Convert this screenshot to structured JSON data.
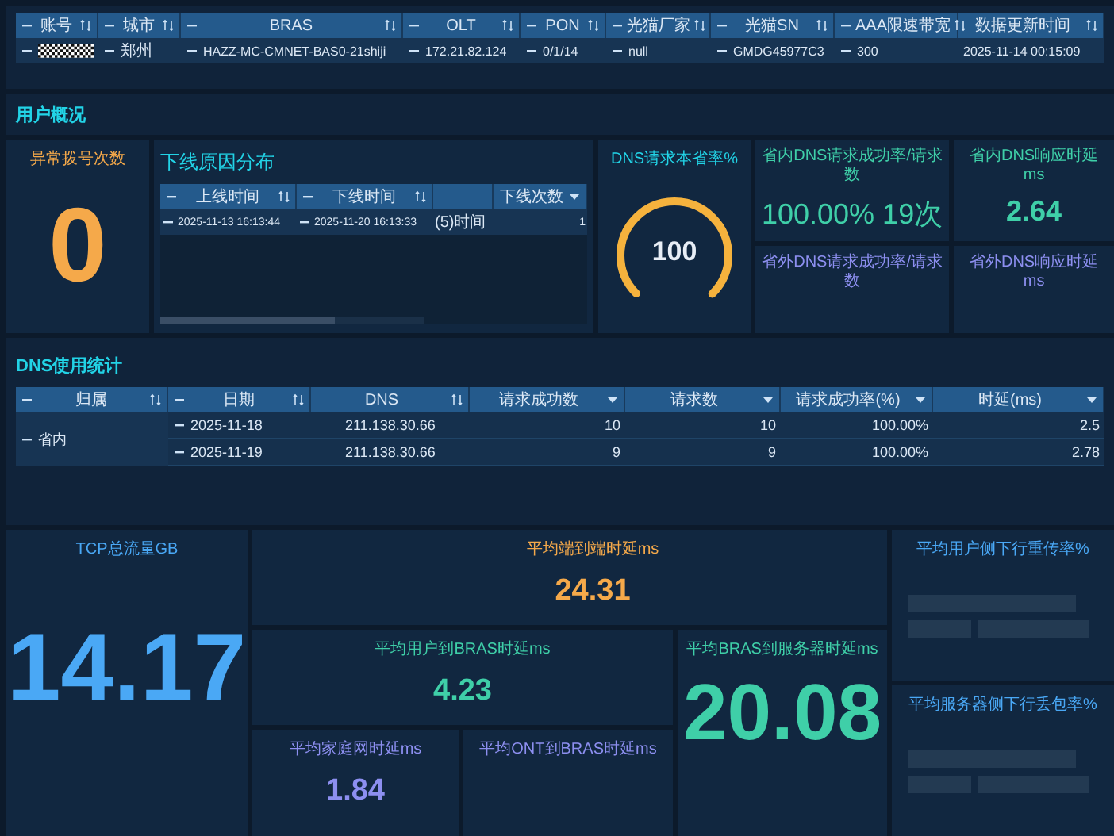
{
  "user_table": {
    "columns": [
      {
        "label": "账号",
        "kind": "filter"
      },
      {
        "label": "城市",
        "kind": "filter"
      },
      {
        "label": "BRAS",
        "kind": "filter"
      },
      {
        "label": "OLT",
        "kind": "filter"
      },
      {
        "label": "PON",
        "kind": "filter"
      },
      {
        "label": "光猫厂家",
        "kind": "filter"
      },
      {
        "label": "光猫SN",
        "kind": "filter"
      },
      {
        "label": "AAA限速带宽",
        "kind": "filter"
      },
      {
        "label": "数据更新时间",
        "kind": "sort"
      }
    ],
    "rows": [
      {
        "cells": [
          {
            "kind": "masked"
          },
          "郑州",
          "HAZZ-MC-CMNET-BAS0-21shiji",
          "172.21.82.124",
          "0/1/14",
          "null",
          "GMDG45977C3",
          "300",
          "2025-11-14 00:15:09"
        ]
      }
    ]
  },
  "overview": {
    "title": "用户概况",
    "abnormal": {
      "label": "异常拨号次数",
      "value": "0"
    },
    "offline": {
      "title": "下线原因分布",
      "columns": [
        {
          "label": "上线时间",
          "kind": "filter"
        },
        {
          "label": "下线时间",
          "kind": "filter"
        },
        {
          "kind": "plain"
        },
        {
          "label": "下线次数",
          "kind": "dropdown"
        }
      ],
      "rows": [
        {
          "cells": [
            "2025-11-13 16:13:44",
            "2025-11-20 16:13:33",
            "(5)时间",
            "1"
          ]
        }
      ]
    },
    "gauge": {
      "label": "DNS请求本省率%",
      "value": "100"
    },
    "metrics": [
      {
        "label": "省内DNS请求成功率/请求数",
        "kind": "value",
        "value": "100.00% 19次",
        "color": "#3fcfa8"
      },
      {
        "label": "省内DNS响应时延ms",
        "kind": "value",
        "value": "2.64",
        "color": "#3fcfa8"
      },
      {
        "label": "省外DNS请求成功率/请求数",
        "kind": "empty"
      },
      {
        "label": "省外DNS响应时延ms",
        "kind": "empty"
      }
    ]
  },
  "dns": {
    "title": "DNS使用统计",
    "columns": [
      {
        "label": "归属",
        "kind": "filter"
      },
      {
        "label": "日期",
        "kind": "filter"
      },
      {
        "label": "DNS",
        "kind": "sort"
      },
      {
        "label": "请求成功数",
        "kind": "dropdown"
      },
      {
        "label": "请求数",
        "kind": "dropdown"
      },
      {
        "label": "请求成功率(%)",
        "kind": "dropdown"
      },
      {
        "label": "时延(ms)",
        "kind": "dropdown"
      }
    ],
    "groups": [
      {
        "label": "省内",
        "rows": [
          {
            "cells": [
              "2025-11-18",
              "211.138.30.66",
              "10",
              "10",
              "100.00%",
              "2.5"
            ]
          },
          {
            "cells": [
              "2025-11-19",
              "211.138.30.66",
              "9",
              "9",
              "100.00%",
              "2.78"
            ]
          }
        ]
      }
    ]
  },
  "bottom": [
    {
      "label": "TCP总流量GB",
      "kind": "value",
      "value": "14.17",
      "color": "#4aa8f5"
    },
    {
      "label": "平均端到端时延ms",
      "kind": "value",
      "value": "24.31",
      "color": "#f5a94a"
    },
    {
      "label": "平均用户到BRAS时延ms",
      "kind": "value",
      "value": "4.23",
      "color": "#3fcfa8"
    },
    {
      "label": "平均家庭网时延ms",
      "kind": "value",
      "value": "1.84",
      "color": "#8d8ff0"
    },
    {
      "label": "平均ONT到BRAS时延ms",
      "kind": "empty"
    },
    {
      "label": "平均BRAS到服务器时延ms",
      "kind": "value",
      "value": "20.08",
      "color": "#3fcfa8"
    },
    {
      "label": "平均用户侧下行重传率%",
      "kind": "loading"
    },
    {
      "label": "平均服务器侧下行丢包率%",
      "kind": "loading"
    }
  ]
}
